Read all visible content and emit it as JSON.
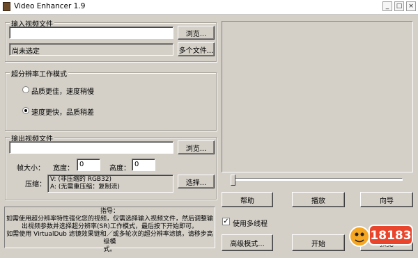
{
  "window": {
    "title": "Video Enhancer 1.9",
    "min": "_",
    "max": "□",
    "close": "×"
  },
  "input_group": {
    "title": "输入视频文件",
    "path_value": "",
    "browse_label": "浏览...",
    "status_text": "尚未选定",
    "multi_label": "多个文件..."
  },
  "mode_group": {
    "title": "超分辨率工作模式",
    "option_quality": "品质更佳，速度稍慢",
    "option_speed": "速度更快，品质稍差",
    "selected": "speed"
  },
  "output_group": {
    "title": "输出视频文件",
    "path_value": "",
    "browse_label": "浏览...",
    "frame_size_label": "帧大小：",
    "width_label": "宽度：",
    "width_value": "0",
    "height_label": "高度：",
    "height_value": "0",
    "compress_label": "压缩：",
    "compress_info_v": "V: (非压缩的 RGB32)",
    "compress_info_a": "A: (无需重压缩：复制流)",
    "choose_label": "选择..."
  },
  "guide": {
    "title": "指导：",
    "line1": "如需使用超分辨率特性强化您的视频，仅需选择输入视频文件，然后调整输",
    "line2": "出视频参数并选择超分辨率(SR)工作模式，最后按下开始即可。",
    "line3": "如需使用 VirtualDub 滤镜效果链和／或多轮次的超分辨率滤镜，请移步高级模",
    "line4": "式。"
  },
  "controls": {
    "help_label": "帮助",
    "play_label": "播放",
    "wizard_label": "向导",
    "multithread_label": "使用多线程",
    "multithread_checked": true,
    "advanced_label": "高级模式...",
    "start_label": "开始",
    "preview_label": "预览"
  },
  "watermark": {
    "text": "18183"
  }
}
